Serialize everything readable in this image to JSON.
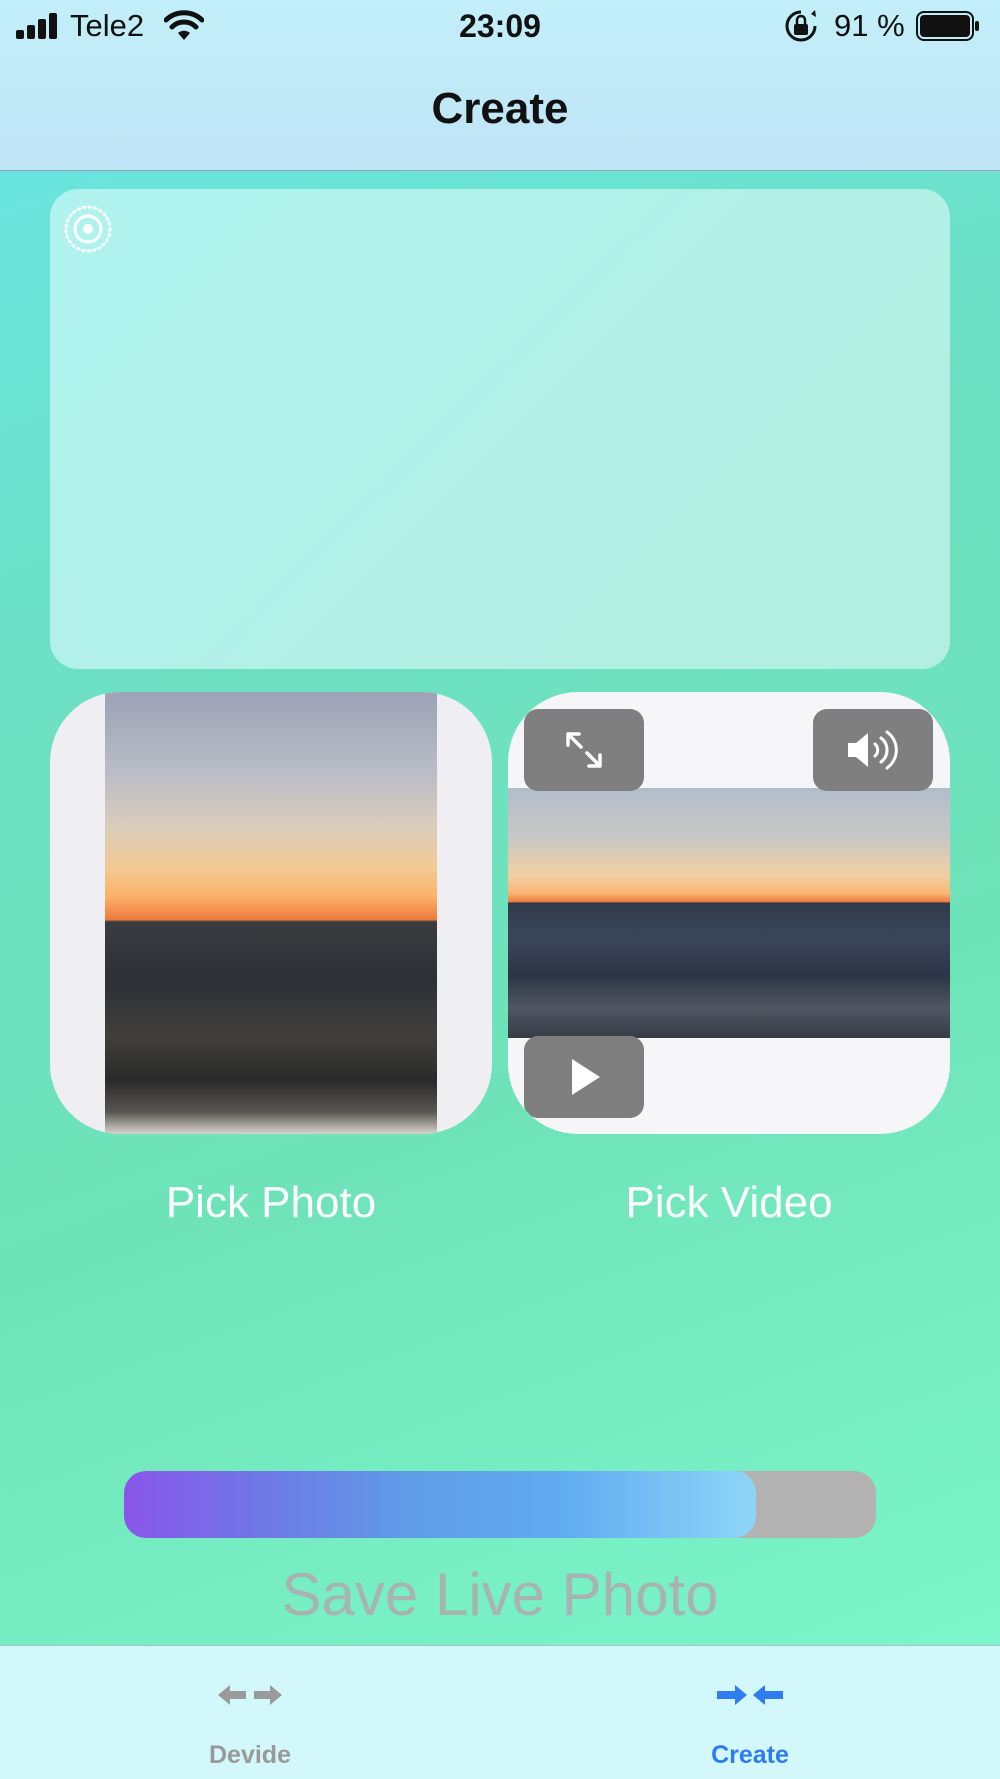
{
  "status_bar": {
    "carrier": "Tele2",
    "time": "23:09",
    "battery_percent": "91 %"
  },
  "nav": {
    "title": "Create"
  },
  "preview": {
    "icon": "live-photo-icon"
  },
  "photo_picker": {
    "label": "Pick Photo"
  },
  "video_picker": {
    "label": "Pick Video",
    "controls": [
      "expand-icon",
      "speaker-icon",
      "play-icon"
    ]
  },
  "progress": {
    "value": 0.84,
    "fill_color_start": "#8a55ea",
    "fill_color_end": "#8fd5f7",
    "track_color": "#b2b2b2"
  },
  "save": {
    "label": "Save Live Photo"
  },
  "tabbar": {
    "tabs": [
      {
        "label": "Devide",
        "icon": "divide-arrows-icon",
        "active": false,
        "color": "#999999"
      },
      {
        "label": "Create",
        "icon": "merge-arrows-icon",
        "active": true,
        "color": "#2f7cf0"
      }
    ]
  }
}
